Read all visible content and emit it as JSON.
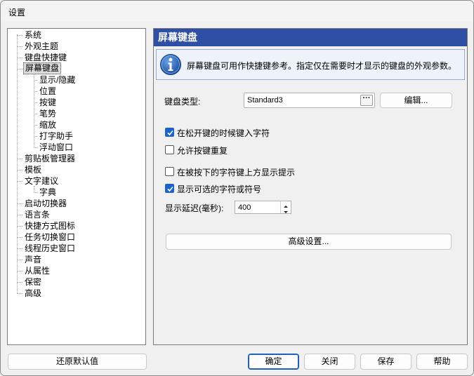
{
  "window": {
    "title": "设置"
  },
  "tree": {
    "items": [
      {
        "label": "系统",
        "level": 0
      },
      {
        "label": "外观主题",
        "level": 0
      },
      {
        "label": "键盘快捷键",
        "level": 0
      },
      {
        "label": "屏幕键盘",
        "level": 0,
        "selected": true
      },
      {
        "label": "显示/隐藏",
        "level": 1
      },
      {
        "label": "位置",
        "level": 1
      },
      {
        "label": "按键",
        "level": 1
      },
      {
        "label": "笔势",
        "level": 1
      },
      {
        "label": "缩放",
        "level": 1
      },
      {
        "label": "打字助手",
        "level": 1
      },
      {
        "label": "浮动窗口",
        "level": 1
      },
      {
        "label": "剪贴板管理器",
        "level": 0
      },
      {
        "label": "模板",
        "level": 0
      },
      {
        "label": "文字建议",
        "level": 0
      },
      {
        "label": "字典",
        "level": 1
      },
      {
        "label": "启动切换器",
        "level": 0
      },
      {
        "label": "语言条",
        "level": 0
      },
      {
        "label": "快捷方式图标",
        "level": 0
      },
      {
        "label": "任务切换窗口",
        "level": 0
      },
      {
        "label": "线程历史窗口",
        "level": 0
      },
      {
        "label": "声音",
        "level": 0
      },
      {
        "label": "从属性",
        "level": 0
      },
      {
        "label": "保密",
        "level": 0
      },
      {
        "label": "高级",
        "level": 0
      }
    ]
  },
  "panel": {
    "title": "屏幕键盘",
    "info": "屏幕键盘可用作快捷键参考。指定仅在需要时才显示的键盘的外观参数。",
    "keyboard_type_label": "键盘类型:",
    "keyboard_type_value": "Standard3",
    "ellipsis": "···",
    "edit_button": "编辑...",
    "options": [
      {
        "label": "在松开键的时候键入字符",
        "checked": true
      },
      {
        "label": "允许按键重复",
        "checked": false
      },
      {
        "label": "在被按下的字符键上方显示提示",
        "checked": false
      },
      {
        "label": "显示可选的字符或符号",
        "checked": true
      }
    ],
    "delay_label": "显示延迟(毫秒):",
    "delay_value": "400",
    "advanced_button": "高级设置..."
  },
  "footer": {
    "reset": "还原默认值",
    "ok": "确定",
    "close": "关闭",
    "save": "保存",
    "help": "帮助"
  },
  "colors": {
    "header_bg": "#2f4fa5",
    "accent": "#1e63c8"
  }
}
